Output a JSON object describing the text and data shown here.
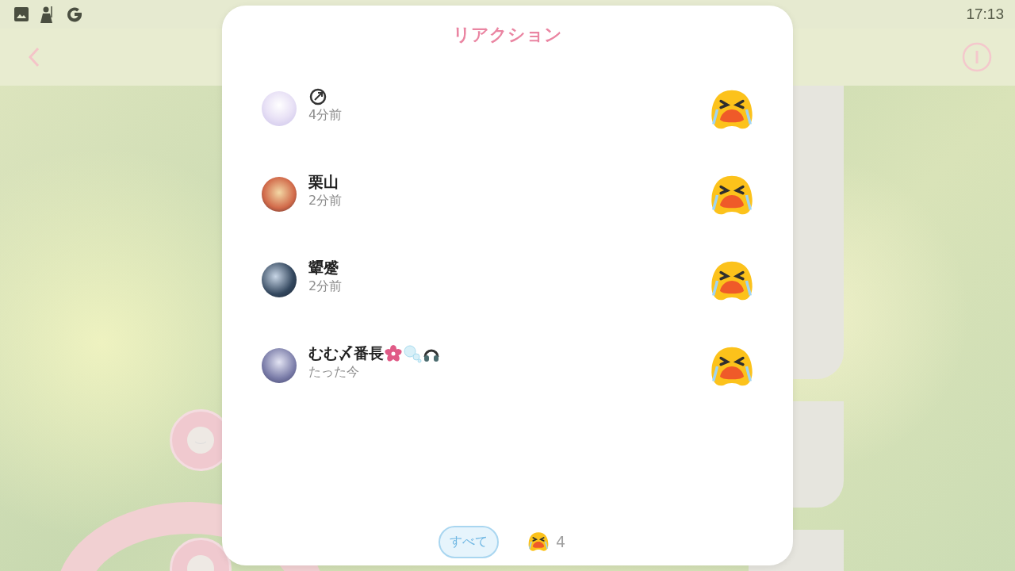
{
  "status_bar": {
    "time": "17:13"
  },
  "modal": {
    "title": "リアクション",
    "reactions": [
      {
        "name_parts": [
          {
            "kind": "compass"
          }
        ],
        "time": "4分前"
      },
      {
        "name_parts": [
          {
            "kind": "text",
            "text": "栗山"
          }
        ],
        "time": "2分前"
      },
      {
        "name_parts": [
          {
            "kind": "text",
            "text": "顰蹙"
          }
        ],
        "time": "2分前"
      },
      {
        "name_parts": [
          {
            "kind": "text",
            "text": "むむ〆番長"
          },
          {
            "kind": "flower"
          },
          {
            "kind": "bubbles"
          },
          {
            "kind": "headphones"
          }
        ],
        "time": "たった今"
      }
    ],
    "filters": [
      {
        "kind": "all",
        "label": "すべて",
        "selected": true
      },
      {
        "kind": "reaction",
        "count": "4",
        "selected": false
      }
    ]
  }
}
